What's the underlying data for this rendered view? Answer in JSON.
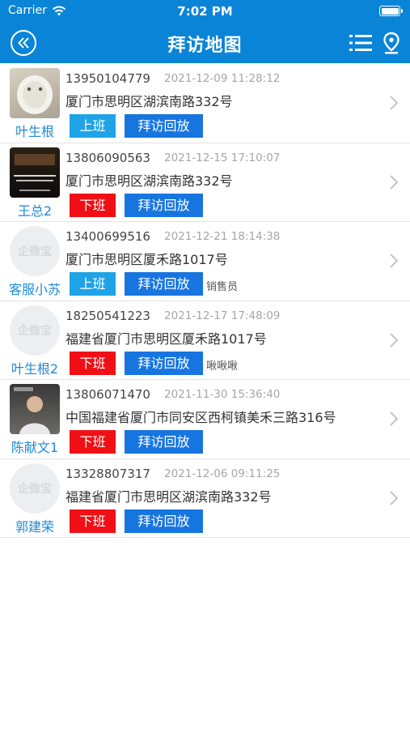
{
  "status_bar": {
    "carrier": "Carrier",
    "time": "7:02 PM"
  },
  "nav": {
    "title": "拜访地图"
  },
  "colors": {
    "primary": "#0a84d6",
    "on_duty": "#1fa3e6",
    "off_duty": "#f10f16",
    "replay": "#1775e0",
    "name": "#1f8ad6"
  },
  "visits": [
    {
      "name": "叶生根",
      "avatar": "photo-vase",
      "phone": "13950104779",
      "datetime": "2021-12-09 11:28:12",
      "address": "厦门市思明区湖滨南路332号",
      "status_label": "上班",
      "status_type": "on",
      "replay_label": "拜访回放",
      "note": ""
    },
    {
      "name": "王总2",
      "avatar": "photo-dark",
      "phone": "13806090563",
      "datetime": "2021-12-15 17:10:07",
      "address": "厦门市思明区湖滨南路332号",
      "status_label": "下班",
      "status_type": "off",
      "replay_label": "拜访回放",
      "note": ""
    },
    {
      "name": "客服小苏",
      "avatar": "placeholder-logo",
      "avatar_text": "企微宝",
      "phone": "13400699516",
      "datetime": "2021-12-21 18:14:38",
      "address": "厦门市思明区厦禾路1017号",
      "status_label": "上班",
      "status_type": "on",
      "replay_label": "拜访回放",
      "note": "销售员"
    },
    {
      "name": "叶生根2",
      "avatar": "placeholder-logo",
      "avatar_text": "企微宝",
      "phone": "18250541223",
      "datetime": "2021-12-17 17:48:09",
      "address": "福建省厦门市思明区厦禾路1017号",
      "status_label": "下班",
      "status_type": "off",
      "replay_label": "拜访回放",
      "note": "啾啾啾"
    },
    {
      "name": "陈献文1",
      "avatar": "photo-person",
      "phone": "13806071470",
      "datetime": "2021-11-30 15:36:40",
      "address": "中国福建省厦门市同安区西柯镇美禾三路316号",
      "status_label": "下班",
      "status_type": "off",
      "replay_label": "拜访回放",
      "note": ""
    },
    {
      "name": "郭建荣",
      "avatar": "placeholder-logo",
      "avatar_text": "企微宝",
      "phone": "13328807317",
      "datetime": "2021-12-06 09:11:25",
      "address": "福建省厦门市思明区湖滨南路332号",
      "status_label": "下班",
      "status_type": "off",
      "replay_label": "拜访回放",
      "note": ""
    }
  ]
}
